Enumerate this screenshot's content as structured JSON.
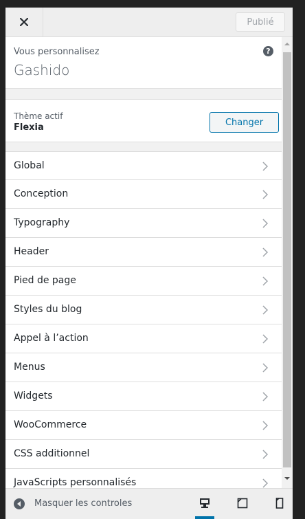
{
  "header": {
    "close_icon": "close-icon",
    "publish_label": "Publié"
  },
  "info": {
    "title": "Vous personnalisez",
    "site_name": "Gashido",
    "help_icon": "?"
  },
  "theme": {
    "label": "Thème actif",
    "name": "Flexia",
    "change_label": "Changer"
  },
  "menu": {
    "items": [
      "Global",
      "Conception",
      "Typography",
      "Header",
      "Pied de page",
      "Styles du blog",
      "Appel à l’action",
      "Menus",
      "Widgets",
      "WooCommerce",
      "CSS additionnel",
      "JavaScripts personnalisés"
    ]
  },
  "footer": {
    "collapse_label": "Masquer les controles",
    "devices": [
      "desktop-icon",
      "tablet-icon",
      "mobile-icon"
    ],
    "active_device": "desktop"
  },
  "colors": {
    "accent": "#0073aa",
    "panel_bg": "#f1f1f1",
    "item_bg": "#ffffff",
    "text": "#23282d",
    "muted": "#555d66",
    "outer_bg": "#222222"
  }
}
